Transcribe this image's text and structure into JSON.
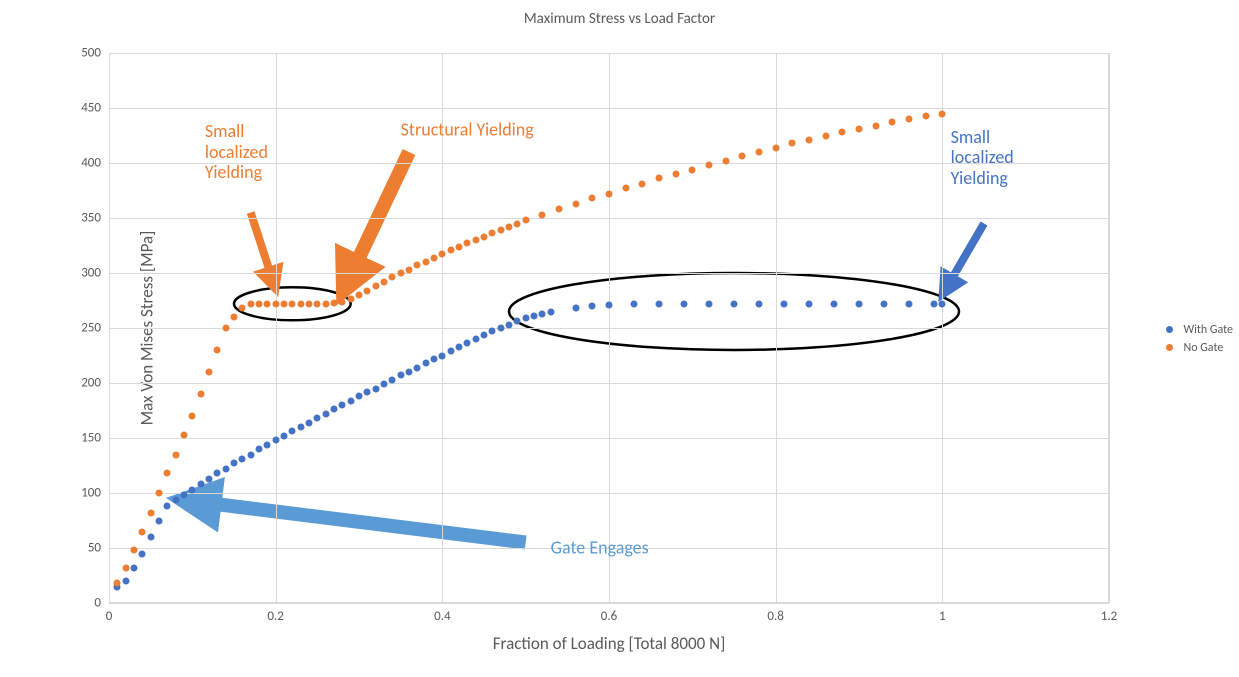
{
  "chart_data": {
    "type": "scatter",
    "title": "Maximum Stress vs Load Factor",
    "xlabel": "Fraction of Loading [Total 8000 N]",
    "ylabel": "Max Von Mises Stress [MPa]",
    "xlim": [
      0,
      1.2
    ],
    "ylim": [
      0,
      500
    ],
    "x_ticks": [
      0,
      0.2,
      0.4,
      0.6,
      0.8,
      1,
      1.2
    ],
    "y_ticks": [
      0,
      50,
      100,
      150,
      200,
      250,
      300,
      350,
      400,
      450,
      500
    ],
    "grid": true,
    "legend_position": "right",
    "series": [
      {
        "name": "With Gate",
        "color": "#4472c4",
        "points": [
          [
            0.01,
            15
          ],
          [
            0.02,
            20
          ],
          [
            0.03,
            32
          ],
          [
            0.04,
            45
          ],
          [
            0.05,
            60
          ],
          [
            0.06,
            75
          ],
          [
            0.07,
            88
          ],
          [
            0.08,
            94
          ],
          [
            0.09,
            98
          ],
          [
            0.1,
            103
          ],
          [
            0.11,
            108
          ],
          [
            0.12,
            113
          ],
          [
            0.13,
            118
          ],
          [
            0.14,
            122
          ],
          [
            0.15,
            127
          ],
          [
            0.16,
            131
          ],
          [
            0.17,
            135
          ],
          [
            0.18,
            140
          ],
          [
            0.19,
            144
          ],
          [
            0.2,
            148
          ],
          [
            0.21,
            152
          ],
          [
            0.22,
            156
          ],
          [
            0.23,
            160
          ],
          [
            0.24,
            164
          ],
          [
            0.25,
            168
          ],
          [
            0.26,
            172
          ],
          [
            0.27,
            176
          ],
          [
            0.28,
            180
          ],
          [
            0.29,
            184
          ],
          [
            0.3,
            188
          ],
          [
            0.31,
            192
          ],
          [
            0.32,
            195
          ],
          [
            0.33,
            199
          ],
          [
            0.34,
            203
          ],
          [
            0.35,
            207
          ],
          [
            0.36,
            210
          ],
          [
            0.37,
            214
          ],
          [
            0.38,
            218
          ],
          [
            0.39,
            222
          ],
          [
            0.4,
            225
          ],
          [
            0.41,
            229
          ],
          [
            0.42,
            233
          ],
          [
            0.43,
            236
          ],
          [
            0.44,
            240
          ],
          [
            0.45,
            244
          ],
          [
            0.46,
            247
          ],
          [
            0.47,
            250
          ],
          [
            0.48,
            253
          ],
          [
            0.49,
            256
          ],
          [
            0.5,
            259
          ],
          [
            0.51,
            261
          ],
          [
            0.52,
            263
          ],
          [
            0.53,
            265
          ],
          [
            0.56,
            268
          ],
          [
            0.58,
            270
          ],
          [
            0.6,
            271
          ],
          [
            0.63,
            272
          ],
          [
            0.66,
            272
          ],
          [
            0.69,
            272
          ],
          [
            0.72,
            272
          ],
          [
            0.75,
            272
          ],
          [
            0.78,
            272
          ],
          [
            0.81,
            272
          ],
          [
            0.84,
            272
          ],
          [
            0.87,
            272
          ],
          [
            0.9,
            272
          ],
          [
            0.93,
            272
          ],
          [
            0.96,
            272
          ],
          [
            0.99,
            272
          ],
          [
            1.0,
            272
          ]
        ]
      },
      {
        "name": "No Gate",
        "color": "#ed7d31",
        "points": [
          [
            0.01,
            18
          ],
          [
            0.02,
            32
          ],
          [
            0.03,
            48
          ],
          [
            0.04,
            65
          ],
          [
            0.05,
            82
          ],
          [
            0.06,
            100
          ],
          [
            0.07,
            118
          ],
          [
            0.08,
            135
          ],
          [
            0.09,
            153
          ],
          [
            0.1,
            170
          ],
          [
            0.11,
            190
          ],
          [
            0.12,
            210
          ],
          [
            0.13,
            230
          ],
          [
            0.14,
            250
          ],
          [
            0.15,
            260
          ],
          [
            0.16,
            268
          ],
          [
            0.17,
            272
          ],
          [
            0.18,
            272
          ],
          [
            0.19,
            272
          ],
          [
            0.2,
            272
          ],
          [
            0.21,
            272
          ],
          [
            0.22,
            272
          ],
          [
            0.23,
            272
          ],
          [
            0.24,
            272
          ],
          [
            0.25,
            272
          ],
          [
            0.26,
            272
          ],
          [
            0.27,
            273
          ],
          [
            0.28,
            274
          ],
          [
            0.29,
            276
          ],
          [
            0.3,
            280
          ],
          [
            0.31,
            284
          ],
          [
            0.32,
            288
          ],
          [
            0.33,
            292
          ],
          [
            0.34,
            296
          ],
          [
            0.35,
            300
          ],
          [
            0.36,
            303
          ],
          [
            0.37,
            307
          ],
          [
            0.38,
            310
          ],
          [
            0.39,
            314
          ],
          [
            0.4,
            317
          ],
          [
            0.41,
            321
          ],
          [
            0.42,
            324
          ],
          [
            0.43,
            327
          ],
          [
            0.44,
            330
          ],
          [
            0.45,
            333
          ],
          [
            0.46,
            336
          ],
          [
            0.47,
            339
          ],
          [
            0.48,
            342
          ],
          [
            0.49,
            345
          ],
          [
            0.5,
            348
          ],
          [
            0.52,
            353
          ],
          [
            0.54,
            358
          ],
          [
            0.56,
            363
          ],
          [
            0.58,
            368
          ],
          [
            0.6,
            372
          ],
          [
            0.62,
            377
          ],
          [
            0.64,
            381
          ],
          [
            0.66,
            386
          ],
          [
            0.68,
            390
          ],
          [
            0.7,
            394
          ],
          [
            0.72,
            398
          ],
          [
            0.74,
            402
          ],
          [
            0.76,
            406
          ],
          [
            0.78,
            410
          ],
          [
            0.8,
            414
          ],
          [
            0.82,
            418
          ],
          [
            0.84,
            421
          ],
          [
            0.86,
            425
          ],
          [
            0.88,
            428
          ],
          [
            0.9,
            431
          ],
          [
            0.92,
            434
          ],
          [
            0.94,
            437
          ],
          [
            0.96,
            440
          ],
          [
            0.98,
            443
          ],
          [
            1.0,
            445
          ]
        ]
      }
    ],
    "annotations": [
      {
        "id": "small-yield-orange",
        "text": "Small\nlocalized\nYielding",
        "color": "#ed7d31",
        "x": 0.115,
        "y": 410,
        "align": "left"
      },
      {
        "id": "structural-yield",
        "text": "Structural Yielding",
        "color": "#ed7d31",
        "x": 0.35,
        "y": 430,
        "align": "left"
      },
      {
        "id": "small-yield-blue",
        "text": "Small\nlocalized\nYielding",
        "color": "#4472c4",
        "x": 1.01,
        "y": 405,
        "align": "left"
      },
      {
        "id": "gate-engages",
        "text": "Gate Engages",
        "color": "#5b9bd5",
        "x": 0.53,
        "y": 50,
        "align": "left"
      }
    ],
    "arrows": [
      {
        "from": [
          0.17,
          355
        ],
        "to": [
          0.2,
          285
        ],
        "color": "#ed7d31",
        "width": 8
      },
      {
        "from": [
          0.36,
          410
        ],
        "to": [
          0.28,
          282
        ],
        "color": "#ed7d31",
        "width": 14
      },
      {
        "from": [
          1.05,
          345
        ],
        "to": [
          1.0,
          280
        ],
        "color": "#4472c4",
        "width": 8
      },
      {
        "from": [
          0.5,
          55
        ],
        "to": [
          0.085,
          94
        ],
        "color": "#5b9bd5",
        "width": 14
      }
    ],
    "ellipses": [
      {
        "cx": 0.22,
        "cy": 272,
        "rx": 0.07,
        "ry": 15
      },
      {
        "cx": 0.75,
        "cy": 265,
        "rx": 0.27,
        "ry": 35
      }
    ]
  },
  "legend": {
    "items": [
      {
        "label": "With Gate",
        "color": "#4472c4"
      },
      {
        "label": "No Gate",
        "color": "#ed7d31"
      }
    ]
  }
}
